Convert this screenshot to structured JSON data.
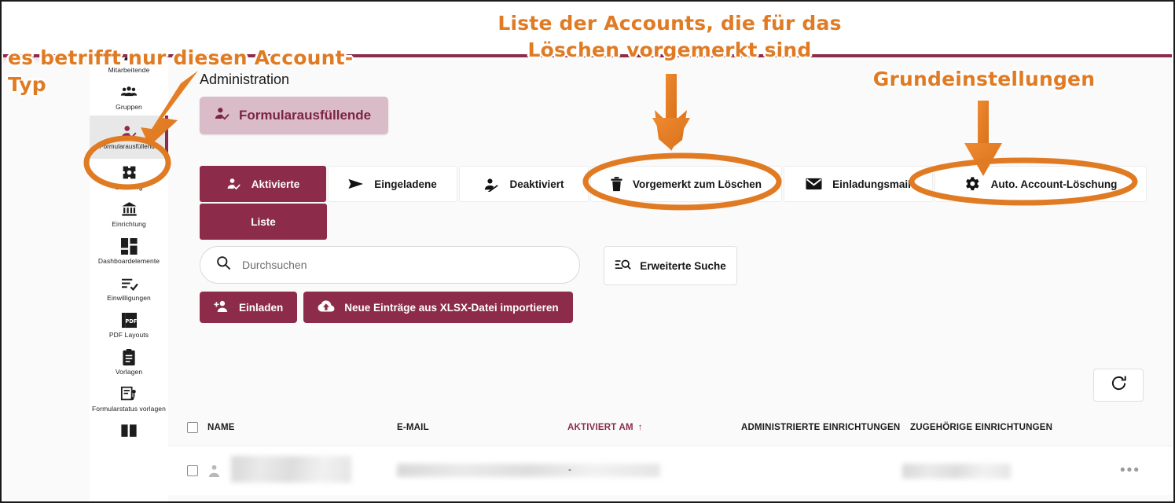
{
  "app": {
    "page_title": "Administration",
    "account_type_chip": "Formularausfüllende"
  },
  "sidebar": {
    "items": [
      {
        "label": "Mitarbeitende",
        "icon": "person-badge-icon",
        "active": false,
        "partial": true
      },
      {
        "label": "Gruppen",
        "icon": "group-people-icon",
        "active": false
      },
      {
        "label": "Formularausfüllende",
        "icon": "person-check-icon",
        "active": true
      },
      {
        "label": "Branding",
        "icon": "gear-icon",
        "active": false
      },
      {
        "label": "Einrichtung",
        "icon": "bank-icon",
        "active": false
      },
      {
        "label": "Dashboardelemente",
        "icon": "dashboard-grid-icon",
        "active": false
      },
      {
        "label": "Einwilligungen",
        "icon": "list-check-icon",
        "active": false
      },
      {
        "label": "PDF Layouts",
        "icon": "pdf-file-icon",
        "active": false
      },
      {
        "label": "Vorlagen",
        "icon": "clipboard-icon",
        "active": false
      },
      {
        "label": "Formularstatus vorlagen",
        "icon": "form-status-icon",
        "active": false
      },
      {
        "label": "",
        "icon": "book-icon",
        "active": false
      }
    ]
  },
  "tabs": {
    "primary": [
      {
        "label": "Aktivierte",
        "icon": "person-check-icon",
        "active": true
      },
      {
        "label": "Eingeladene",
        "icon": "send-icon",
        "active": false
      },
      {
        "label": "Deaktiviert",
        "icon": "person-off-icon",
        "active": false
      },
      {
        "label": "Vorgemerkt zum Löschen",
        "icon": "trash-icon",
        "active": false
      },
      {
        "label": "Einladungsmail",
        "icon": "mail-icon",
        "active": false
      },
      {
        "label": "Auto. Account-Löschung",
        "icon": "gear-icon",
        "active": false
      }
    ],
    "secondary": [
      {
        "label": "Liste",
        "active": true
      }
    ]
  },
  "search": {
    "placeholder": "Durchsuchen",
    "value": "",
    "advanced_label": "Erweiterte Suche"
  },
  "actions": {
    "invite_label": "Einladen",
    "import_label": "Neue Einträge aus XLSX-Datei importieren",
    "refresh_icon": "refresh-icon"
  },
  "table": {
    "columns": [
      {
        "label": "NAME",
        "sorted": false
      },
      {
        "label": "E-MAIL",
        "sorted": false
      },
      {
        "label": "AKTIVIERT AM",
        "sorted": true,
        "sort_direction": "↑"
      },
      {
        "label": "ADMINISTRIERTE EINRICHTUNGEN",
        "sorted": false
      },
      {
        "label": "ZUGEHÖRIGE EINRICHTUNGEN",
        "sorted": false
      }
    ],
    "rows": [
      {
        "name": "",
        "email": "",
        "aktiviert_am": "-",
        "administrierte_einrichtungen": "",
        "zugehoerige_einrichtungen": "",
        "menu": "•••"
      }
    ]
  },
  "annotations": [
    {
      "id": "account-type-note",
      "text": "es betrifft nur diesen Account-Typ"
    },
    {
      "id": "delete-list-note",
      "text": "Liste der Accounts, die für das\nLöschen vorgemerkt sind"
    },
    {
      "id": "settings-note",
      "text": "Grundeinstellungen"
    }
  ],
  "colors": {
    "brand_maroon": "#8c2b4a",
    "chip_pink": "#d9bcc8",
    "annotation_orange": "#e07b24",
    "page_bg": "#fafafa"
  }
}
